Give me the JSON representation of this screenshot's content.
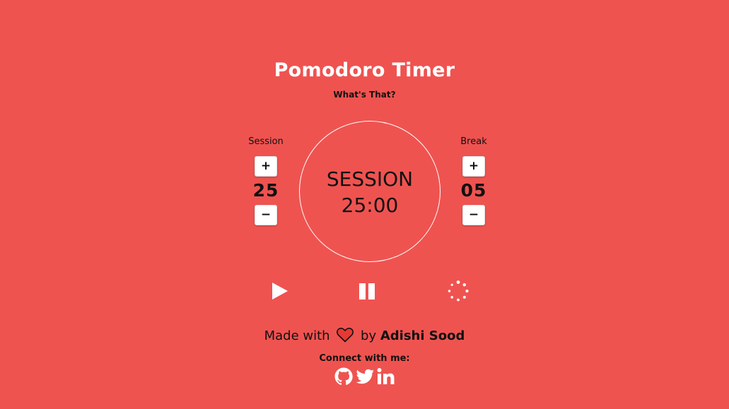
{
  "header": {
    "title": "Pomodoro Timer",
    "subtitle": "What's That?"
  },
  "session": {
    "label": "Session",
    "value": "25",
    "increment": "+",
    "decrement": "−"
  },
  "break": {
    "label": "Break",
    "value": "05",
    "increment": "+",
    "decrement": "−"
  },
  "clock": {
    "label": "SESSION",
    "time": "25:00"
  },
  "controls": {
    "play_icon": "play-icon",
    "pause_icon": "pause-icon",
    "reset_icon": "spinner-icon"
  },
  "footer": {
    "made_with": "Made with",
    "by": "by",
    "author": "Adishi Sood",
    "connect": "Connect with me:",
    "socials": [
      "github-icon",
      "twitter-icon",
      "linkedin-icon"
    ]
  },
  "colors": {
    "background": "#ef5350",
    "title": "#ffffff",
    "heart": "#e53935"
  }
}
